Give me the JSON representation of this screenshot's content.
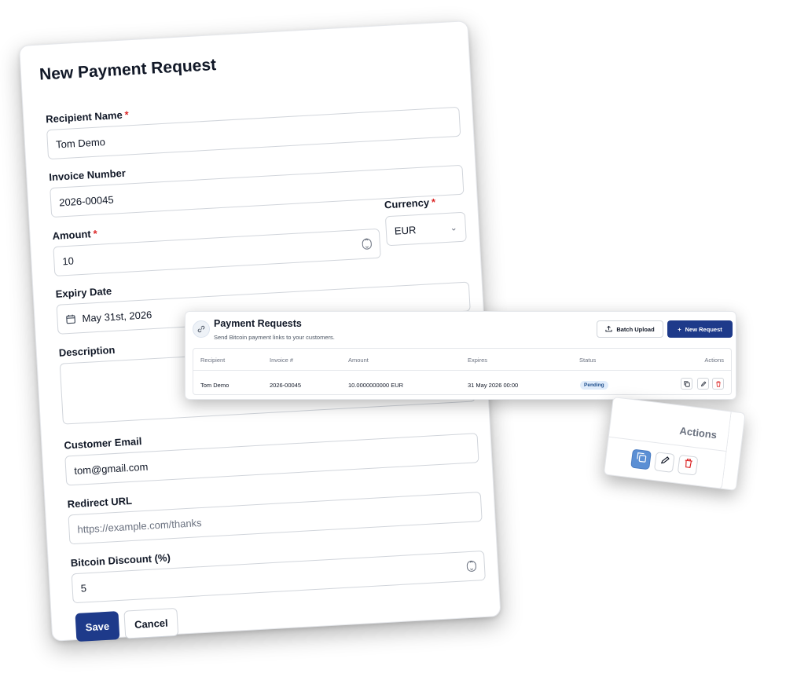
{
  "form": {
    "title": "New Payment Request",
    "fields": {
      "recipient": {
        "label": "Recipient Name",
        "required": "*",
        "value": "Tom Demo"
      },
      "invoice": {
        "label": "Invoice Number",
        "value": "2026-00045"
      },
      "amount": {
        "label": "Amount",
        "required": "*",
        "value": "10"
      },
      "currency": {
        "label": "Currency",
        "required": "*",
        "value": "EUR"
      },
      "expiry": {
        "label": "Expiry Date",
        "value": "May 31st, 2026"
      },
      "description": {
        "label": "Description",
        "value": ""
      },
      "email": {
        "label": "Customer Email",
        "value": "tom@gmail.com"
      },
      "redirect": {
        "label": "Redirect URL",
        "placeholder": "https://example.com/thanks"
      },
      "discount": {
        "label": "Bitcoin Discount (%)",
        "value": "5"
      }
    },
    "buttons": {
      "save": "Save",
      "cancel": "Cancel"
    }
  },
  "payment_requests": {
    "title": "Payment Requests",
    "subtitle": "Send Bitcoin payment links to your customers.",
    "buttons": {
      "batch_upload": "Batch Upload",
      "new_request": "New Request"
    },
    "columns": [
      "Recipient",
      "Invoice #",
      "Amount",
      "Expires",
      "Status",
      "Actions"
    ],
    "rows": [
      {
        "recipient": "Tom Demo",
        "invoice": "2026-00045",
        "amount": "10.0000000000 EUR",
        "expires": "31 May 2026 00:00",
        "status": "Pending",
        "actions": [
          "copy-icon",
          "pencil-icon",
          "trash-icon"
        ]
      }
    ]
  },
  "zoom": {
    "header": "Actions"
  },
  "colors": {
    "primary": "#1e3a8a",
    "danger": "#dc2626",
    "badge_bg": "#e0ecfb",
    "active_copy": "#5b8fd4"
  }
}
